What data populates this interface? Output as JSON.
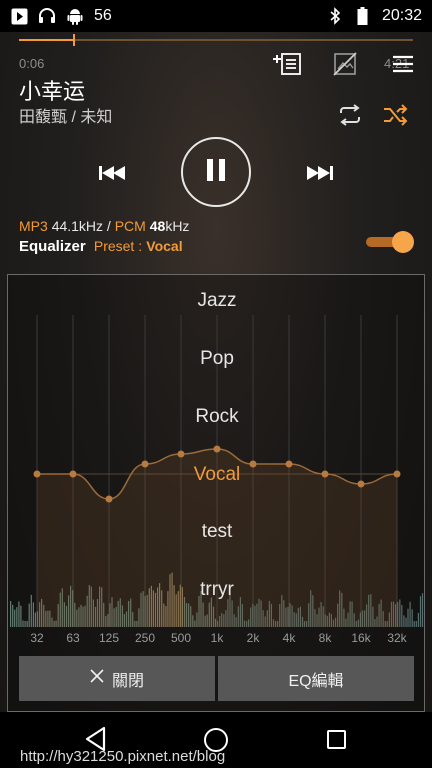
{
  "status_bar": {
    "signal_number": "56",
    "time": "20:32",
    "icons": [
      "play-store-icon",
      "headphones-icon",
      "android-icon",
      "bluetooth-icon",
      "battery-icon"
    ]
  },
  "player": {
    "progress": {
      "elapsed_fraction": 0.14,
      "time_start": "0:06",
      "time_end": "4:21"
    },
    "top_actions": [
      "add-to-playlist-icon",
      "no-album-art-icon",
      "menu-icon"
    ],
    "track": {
      "title": "小幸运",
      "artist_album": "田馥甄 / 未知"
    },
    "modes": {
      "repeat_icon": "repeat-icon",
      "shuffle_icon": "shuffle-icon"
    },
    "controls": [
      "previous-icon",
      "pause-icon",
      "next-icon"
    ],
    "format": {
      "codec": "MP3",
      "rate": "44.1kHz /",
      "output": "PCM",
      "out_rate_bold": "48",
      "out_rate_unit": "kHz"
    },
    "equalizer": {
      "label": "Equalizer",
      "preset_label": "Preset :",
      "preset_value": "Vocal",
      "enabled": true
    }
  },
  "eq_panel": {
    "presets": [
      "Jazz",
      "Pop",
      "Rock",
      "Vocal",
      "test",
      "trryr"
    ],
    "active_preset": "Vocal",
    "bands": [
      "32",
      "63",
      "125",
      "250",
      "500",
      "1k",
      "2k",
      "4k",
      "8k",
      "16k",
      "32k"
    ],
    "band_levels_db": [
      0,
      0,
      -2.5,
      1,
      2,
      2.5,
      1,
      1,
      0,
      -1,
      0
    ],
    "close_button": "關閉",
    "edit_button": "EQ編輯"
  },
  "colors": {
    "accent": "#f39a3a",
    "panel_border": "#6a6a6a",
    "button_bg": "#575757"
  },
  "watermark": "http://hy321250.pixnet.net/blog"
}
